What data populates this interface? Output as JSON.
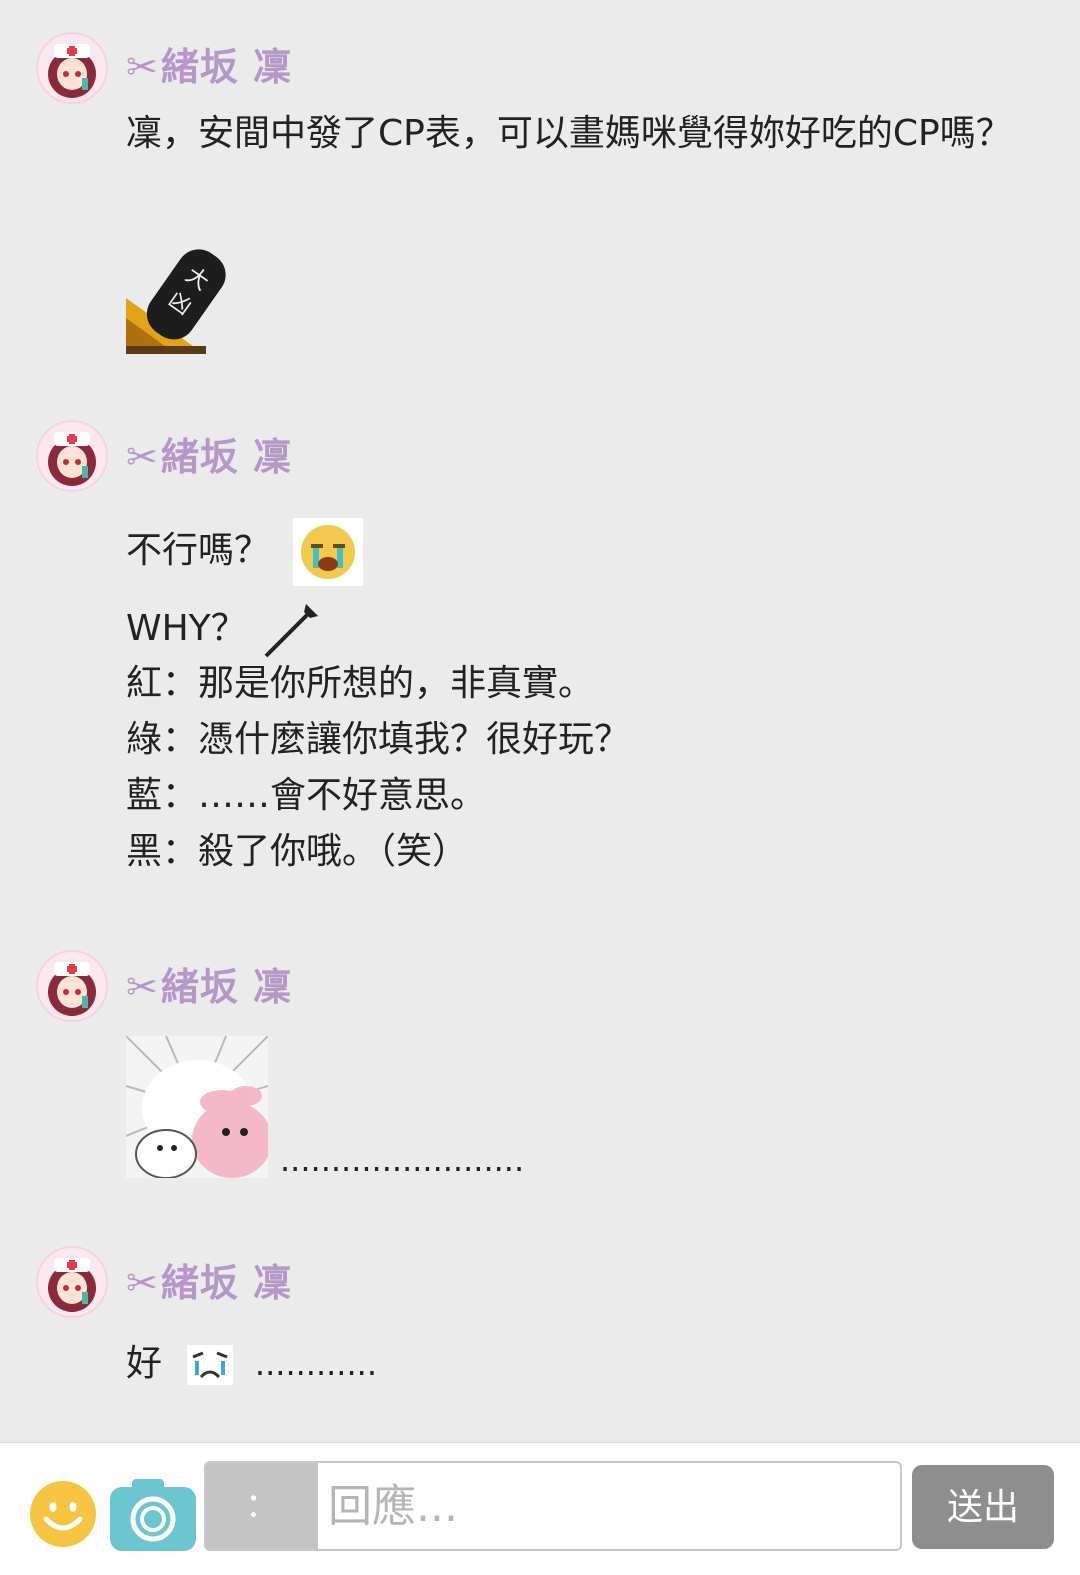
{
  "posts": [
    {
      "author": "緒坂 凜",
      "author_icon": "scissors-icon",
      "lines": [
        "凜，安間中發了CP表，可以畫媽咪覺得妳好吃的CP嗎？"
      ],
      "sticker": "tombstone-sticker-icon"
    },
    {
      "author": "緒坂 凜",
      "author_icon": "scissors-icon",
      "line1": "不行嗎？",
      "line1_icon": "crying-face-icon",
      "line2": "WHY？",
      "line2_icon": "trumpet-icon",
      "lines": [
        "紅：那是你所想的，非真實。",
        "綠：憑什麼讓你填我？很好玩？",
        "藍：……會不好意思。",
        "黑：殺了你哦。（笑）"
      ]
    },
    {
      "author": "緒坂 凜",
      "author_icon": "scissors-icon",
      "sticker": "shocked-bunny-sticker-icon",
      "trailing": "........................"
    },
    {
      "author": "緒坂 凜",
      "author_icon": "scissors-icon",
      "text": "好",
      "icon": "sob-emote-icon",
      "trailing": "............"
    }
  ],
  "reply_bar": {
    "prefix": "：",
    "placeholder": "回應...",
    "send_label": "送出",
    "smile_icon": "smile-icon",
    "camera_icon": "camera-icon"
  },
  "colors": {
    "background": "#ebebeb",
    "author": "#b597c9",
    "send_button": "#8e8e8e",
    "smile": "#f5c542",
    "camera": "#6cc6d0"
  }
}
